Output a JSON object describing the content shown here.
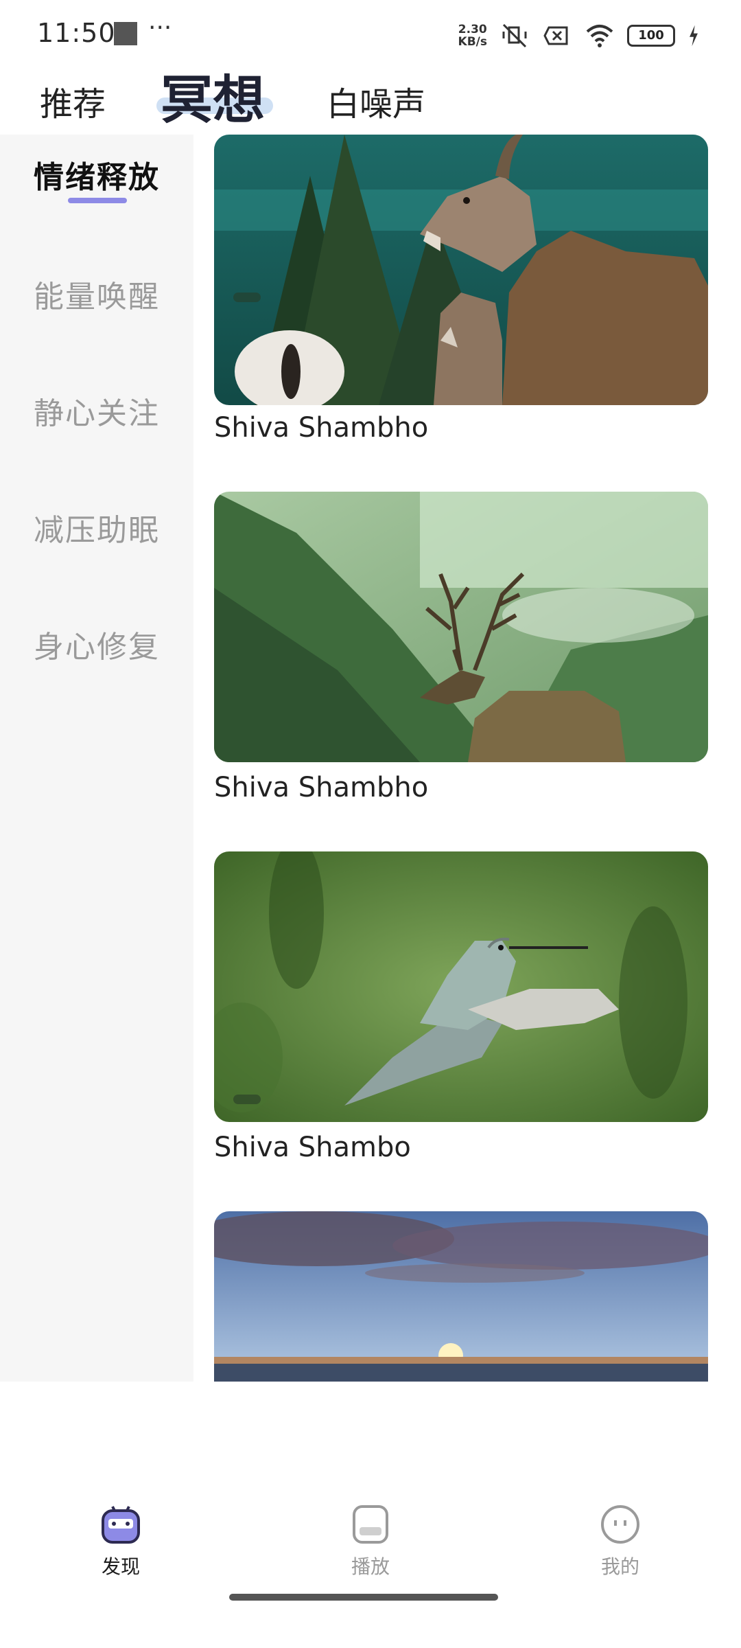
{
  "status": {
    "time": "11:50",
    "more": "···",
    "speed_value": "2.30",
    "speed_unit": "KB/s",
    "battery": "100"
  },
  "top_tabs": [
    {
      "label": "推荐",
      "active": false
    },
    {
      "label": "冥想",
      "active": true
    },
    {
      "label": "白噪声",
      "active": false
    }
  ],
  "sidebar": {
    "items": [
      {
        "label": "情绪释放",
        "active": true
      },
      {
        "label": "能量唤醒",
        "active": false
      },
      {
        "label": "静心关注",
        "active": false
      },
      {
        "label": "减压助眠",
        "active": false
      },
      {
        "label": "身心修复",
        "active": false
      }
    ]
  },
  "cards": [
    {
      "title": "Shiva Shambho",
      "image": "bighorn sheep by a lake"
    },
    {
      "title": "Shiva Shambho",
      "image": "deer in misty mountain valley"
    },
    {
      "title": "Shiva Shambo",
      "image": "hummingbird in flight"
    },
    {
      "title": "",
      "image": "sunset over the sea"
    }
  ],
  "bottom_nav": [
    {
      "label": "发现",
      "icon": "robot-icon",
      "active": true
    },
    {
      "label": "播放",
      "icon": "play-card-icon",
      "active": false
    },
    {
      "label": "我的",
      "icon": "face-icon",
      "active": false
    }
  ],
  "colors": {
    "accent": "#8d8ae6",
    "sidebar_bg": "#f6f6f6"
  }
}
